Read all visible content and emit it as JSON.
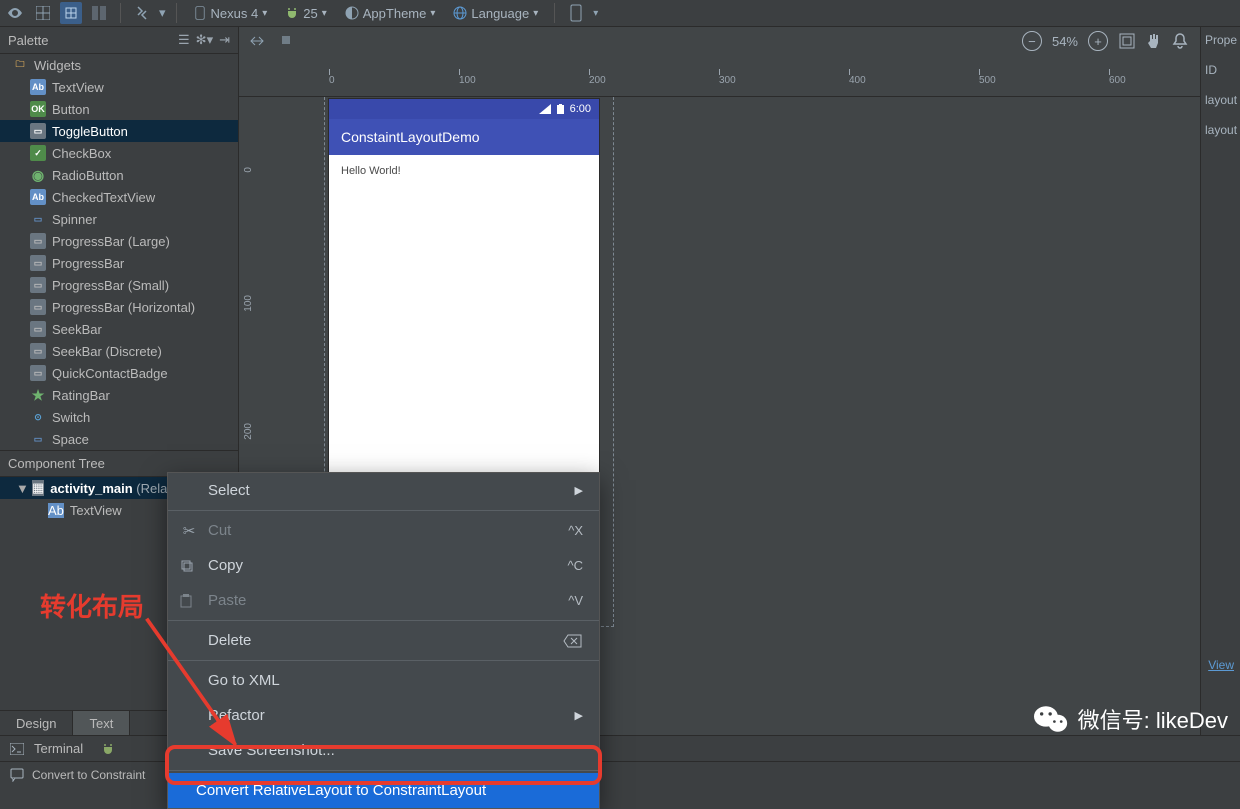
{
  "toolbar": {
    "device": "Nexus 4",
    "api": "25",
    "theme": "AppTheme",
    "language": "Language"
  },
  "palette": {
    "title": "Palette",
    "root": "Widgets",
    "items": [
      "TextView",
      "Button",
      "ToggleButton",
      "CheckBox",
      "RadioButton",
      "CheckedTextView",
      "Spinner",
      "ProgressBar (Large)",
      "ProgressBar",
      "ProgressBar (Small)",
      "ProgressBar (Horizontal)",
      "SeekBar",
      "SeekBar (Discrete)",
      "QuickContactBadge",
      "RatingBar",
      "Switch",
      "Space"
    ],
    "icon_map": [
      "ab",
      "ok",
      "gen",
      "chk",
      "rad",
      "ab",
      "dash",
      "gen",
      "gen",
      "gen",
      "gen",
      "gen",
      "gen",
      "gen",
      "star",
      "swch",
      "dash"
    ],
    "selected_index": 2
  },
  "component_tree": {
    "title": "Component Tree",
    "root": "activity_main",
    "root_suffix": "(RelativeLayout)",
    "child": "TextView"
  },
  "canvas": {
    "zoom": "54%",
    "ruler_h": [
      "0",
      "100",
      "200",
      "300",
      "400",
      "500",
      "600"
    ],
    "ruler_v": [
      "0",
      "100",
      "200"
    ],
    "status_time": "6:00",
    "app_title": "ConstaintLayoutDemo",
    "body_text": "Hello World!"
  },
  "context_menu": {
    "select": "Select",
    "cut": "Cut",
    "cut_sc": "^X",
    "copy": "Copy",
    "copy_sc": "^C",
    "paste": "Paste",
    "paste_sc": "^V",
    "delete": "Delete",
    "go_xml": "Go to XML",
    "refactor": "Refactor",
    "save_ss": "Save Screenshot...",
    "convert": "Convert RelativeLayout to ConstraintLayout"
  },
  "props": {
    "title": "Properties",
    "id_label": "ID",
    "rows": [
      "layout",
      "layout"
    ],
    "view_link": "View"
  },
  "bottom_tabs": {
    "design": "Design",
    "text": "Text"
  },
  "status": {
    "terminal": "Terminal"
  },
  "footer": {
    "text": "Convert to Constraint"
  },
  "watermark": {
    "text": "微信号: likeDev"
  },
  "annotation": "转化布局"
}
